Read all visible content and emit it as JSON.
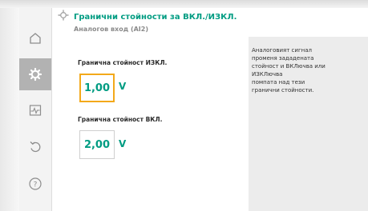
{
  "colors": {
    "accent": "#009c82",
    "focus": "#f3a91a",
    "sidebar_active": "#b2b2b2",
    "help_bg": "#ececec"
  },
  "sidebar": {
    "items": [
      {
        "icon": "home-icon",
        "active": false
      },
      {
        "icon": "gear-icon",
        "active": true
      },
      {
        "icon": "diagnostics-icon",
        "active": false
      },
      {
        "icon": "undo-icon",
        "active": false
      },
      {
        "icon": "help-icon",
        "active": false
      }
    ]
  },
  "header": {
    "breadcrumb_icon": "gear-icon",
    "title": "Гранични стойности за ВКЛ./ИЗКЛ.",
    "subtitle": "Аналогов вход (AI2)"
  },
  "main": {
    "off_threshold": {
      "label": "Гранична стойност ИЗКЛ.",
      "value": "1,00",
      "unit": "V"
    },
    "on_threshold": {
      "label": "Гранична стойност ВКЛ.",
      "value": "2,00",
      "unit": "V"
    }
  },
  "help": {
    "lines": [
      "Аналоговият сигнал",
      "променя зададената",
      "стойност и ВКЛючва или",
      "ИЗКЛючва",
      "помпата над тези",
      "гранични стойности."
    ]
  }
}
